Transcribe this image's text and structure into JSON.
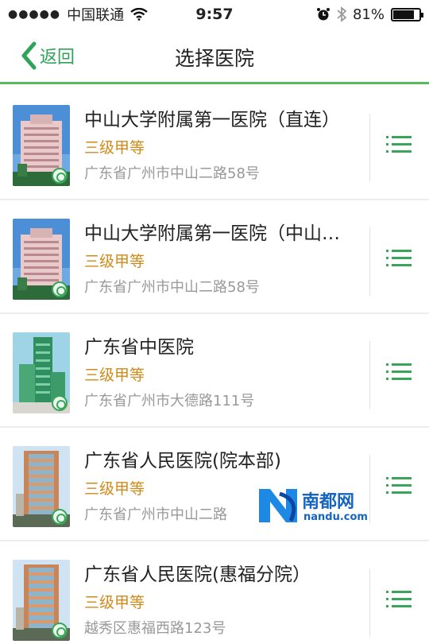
{
  "status_bar": {
    "carrier": "中国联通",
    "time": "9:57",
    "battery": "81%",
    "battery_level": 0.81
  },
  "nav": {
    "back_label": "返回",
    "title": "选择医院"
  },
  "hospitals": [
    {
      "name": "中山大学附属第一医院（直连）",
      "grade": "三级甲等",
      "address": "广东省广州市中山二路58号",
      "image": "pink-building"
    },
    {
      "name": "中山大学附属第一医院（中山…",
      "grade": "三级甲等",
      "address": "广东省广州市中山二路58号",
      "image": "pink-building"
    },
    {
      "name": "广东省中医院",
      "grade": "三级甲等",
      "address": "广东省广州市大德路111号",
      "image": "green-tower"
    },
    {
      "name": "广东省人民医院(院本部)",
      "grade": "三级甲等",
      "address": "广东省广州市中山二路",
      "image": "orange-tower"
    },
    {
      "name": "广东省人民医院(惠福分院）",
      "grade": "三级甲等",
      "address": "越秀区惠福西路123号",
      "image": "orange-tower"
    }
  ],
  "watermark": {
    "brand": "南都网",
    "domain": "nandu.com"
  },
  "colors": {
    "accent": "#3aa55a",
    "grade": "#d08a1a",
    "address": "#999999"
  }
}
